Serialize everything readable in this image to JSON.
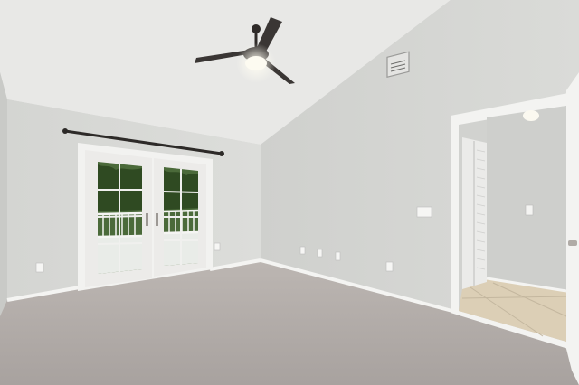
{
  "scene": {
    "subject": "empty-room",
    "colors": {
      "ceiling": "#e9e9e7",
      "wall_left": "#d8d9d6",
      "wall_right": "#d3d4d1",
      "carpet": "#b3adaa",
      "trim": "#f4f4f2",
      "fan_dark": "#3a3634",
      "light_glow": "#fbf6e6",
      "greenery": "#3d5a2c",
      "tile": "#dccfb7",
      "hall_wall": "#cfd0cd"
    }
  }
}
